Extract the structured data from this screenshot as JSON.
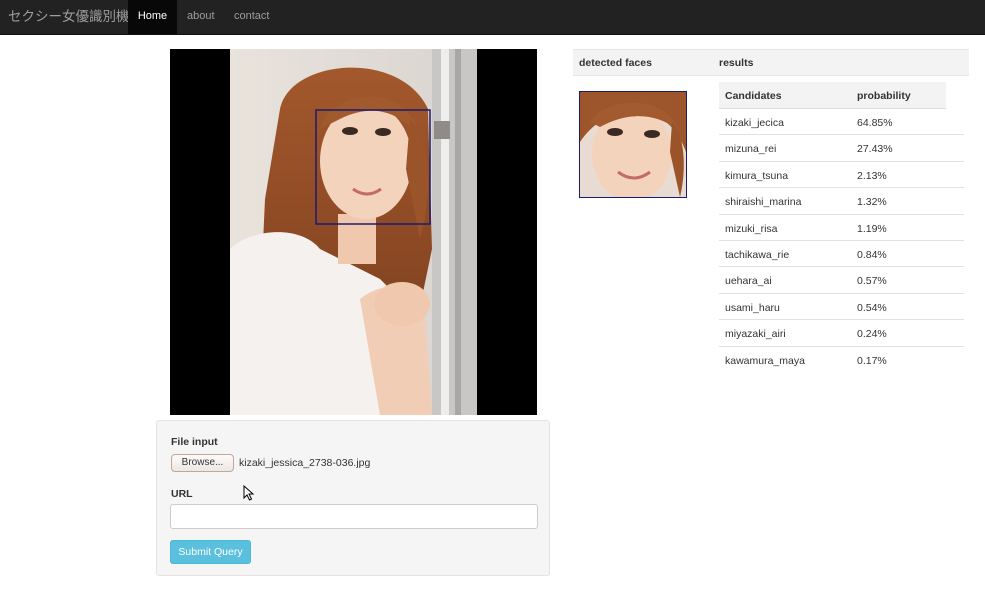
{
  "navbar": {
    "brand": "セクシー女優識別機",
    "items": [
      {
        "label": "Home",
        "active": true
      },
      {
        "label": "about",
        "active": false
      },
      {
        "label": "contact",
        "active": false
      }
    ]
  },
  "form": {
    "file_label": "File input",
    "browse_label": "Browse...",
    "file_name": "kizaki_jessica_2738-036.jpg",
    "url_label": "URL",
    "url_value": "",
    "submit_label": "Submit Query"
  },
  "results": {
    "detected_faces_header": "detected faces",
    "results_header": "results",
    "columns": [
      "Candidates",
      "probability"
    ],
    "candidates": [
      {
        "name": "kizaki_jecica",
        "probability": "64.85%"
      },
      {
        "name": "mizuna_rei",
        "probability": "27.43%"
      },
      {
        "name": "kimura_tsuna",
        "probability": "2.13%"
      },
      {
        "name": "shiraishi_marina",
        "probability": "1.32%"
      },
      {
        "name": "mizuki_risa",
        "probability": "1.19%"
      },
      {
        "name": "tachikawa_rie",
        "probability": "0.84%"
      },
      {
        "name": "uehara_ai",
        "probability": "0.57%"
      },
      {
        "name": "usami_haru",
        "probability": "0.54%"
      },
      {
        "name": "miyazaki_airi",
        "probability": "0.24%"
      },
      {
        "name": "kawamura_maya",
        "probability": "0.17%"
      }
    ]
  },
  "colors": {
    "navbar_bg": "#222222",
    "face_box": "#1b1a6e",
    "submit_bg": "#5bc0de"
  }
}
